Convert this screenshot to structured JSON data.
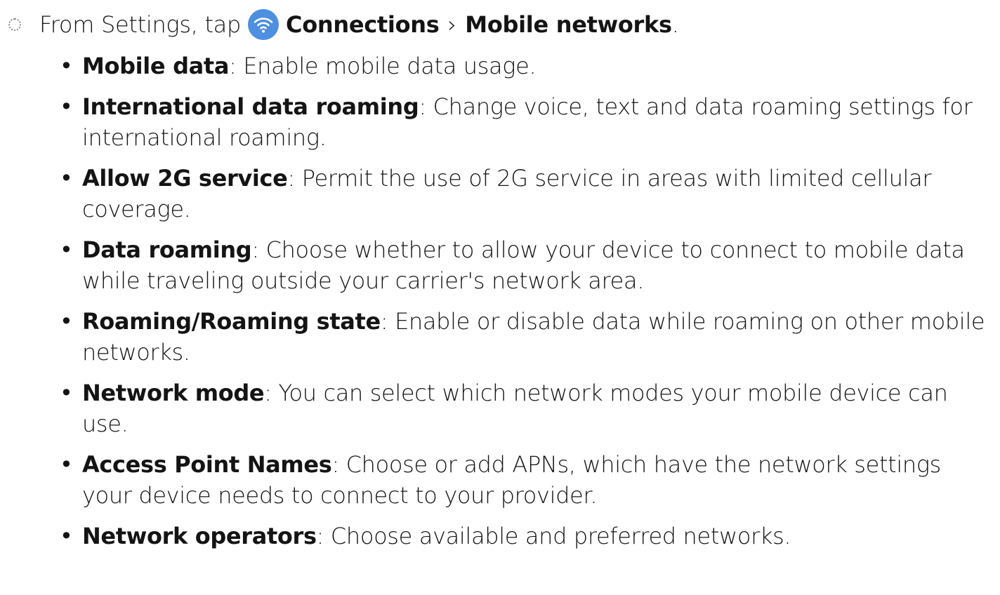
{
  "step": {
    "prefix": "From Settings, tap",
    "icon": "wifi-icon",
    "icon_color": "#4e8fe0",
    "target": "Connections",
    "separator": "›",
    "destination": "Mobile networks",
    "suffix": "."
  },
  "items": [
    {
      "term": "Mobile data",
      "desc": ": Enable mobile data usage."
    },
    {
      "term": "International data roaming",
      "desc": ": Change voice, text and data roaming settings for international roaming."
    },
    {
      "term": "Allow 2G service",
      "desc": ": Permit the use of 2G service in areas with limited cellular coverage."
    },
    {
      "term": "Data roaming",
      "desc": ": Choose whether to allow your device to connect to mobile data while traveling outside your carrier's network area."
    },
    {
      "term": "Roaming/Roaming state",
      "desc": ": Enable or disable data while roaming on other mobile networks."
    },
    {
      "term": "Network mode",
      "desc": ": You can select which network modes your mobile device can use."
    },
    {
      "term": "Access Point Names",
      "desc": ": Choose or add APNs, which have the network settings your device needs to connect to your provider."
    },
    {
      "term": "Network operators",
      "desc": ": Choose available and preferred networks."
    }
  ],
  "bullet": "•"
}
